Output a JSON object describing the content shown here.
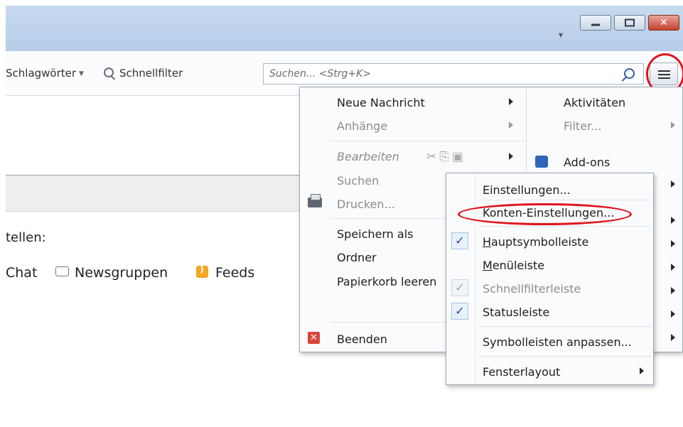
{
  "toolbar": {
    "tag_filter": "Schlagwörter",
    "quick_filter": "Schnellfilter",
    "search_placeholder": "Suchen... <Strg+K>"
  },
  "content": {
    "setup_label": "tellen:",
    "links": [
      "Chat",
      "Newsgruppen",
      "Feeds"
    ]
  },
  "menu_left": {
    "items": [
      "Neue Nachricht",
      "Anhänge",
      "Bearbeiten",
      "Suchen",
      "Drucken...",
      "Speichern als",
      "Ordner",
      "Papierkorb leeren",
      "Beenden"
    ]
  },
  "menu_right": {
    "items": [
      "Aktivitäten",
      "Filter...",
      "Add-ons"
    ]
  },
  "submenu": {
    "items": [
      {
        "label": "Einstellungen...",
        "underline": "",
        "rest": "",
        "checked": false
      },
      {
        "label": "Konten-Einstellungen...",
        "underline": "",
        "rest": "",
        "checked": false
      },
      {
        "label": "",
        "underline": "H",
        "rest": "auptsymbolleiste",
        "checked": true
      },
      {
        "label": "",
        "underline": "M",
        "rest": "enüleiste",
        "checked": false
      },
      {
        "label": "Schnellfilterleiste",
        "underline": "",
        "rest": "",
        "checked": true,
        "disabled": true
      },
      {
        "label": "Statusleiste",
        "underline": "",
        "rest": "",
        "checked": true
      },
      {
        "label": "Symbolleisten anpassen...",
        "underline": "",
        "rest": "",
        "checked": false
      },
      {
        "label": "Fensterlayout",
        "underline": "",
        "rest": "",
        "checked": false
      }
    ]
  },
  "window_controls": {
    "close_glyph": "✕"
  },
  "colors": {
    "annotation_red": "#e0141e",
    "titlebar": "#c6d9ef",
    "check_blue": "#1f4fa0"
  }
}
